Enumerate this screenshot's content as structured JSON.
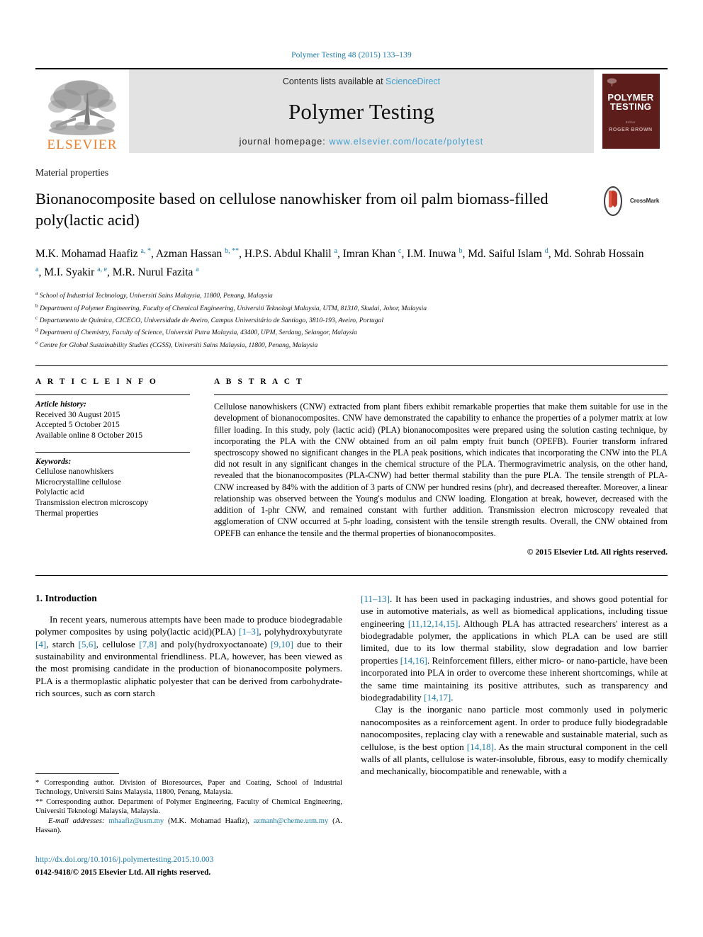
{
  "running_head": "Polymer Testing 48 (2015) 133–139",
  "masthead": {
    "publisher_name": "ELSEVIER",
    "contents_prefix": "Contents lists available at ",
    "contents_link": "ScienceDirect",
    "journal_name": "Polymer Testing",
    "homepage_prefix": "journal homepage: ",
    "homepage_url": "www.elsevier.com/locate/polytest",
    "cover": {
      "title_line1": "POLYMER",
      "title_line2": "TESTING",
      "editor_label": "Editor",
      "editor_name": "ROGER BROWN"
    }
  },
  "article": {
    "kicker": "Material properties",
    "title": "Bionanocomposite based on cellulose nanowhisker from oil palm biomass-filled poly(lactic acid)",
    "crossmark_label": "CrossMark",
    "authors": [
      {
        "name": "M.K. Mohamad Haafiz",
        "marks": "a, *",
        "sep": ", "
      },
      {
        "name": "Azman Hassan",
        "marks": "b, **",
        "sep": ", "
      },
      {
        "name": "H.P.S. Abdul Khalil",
        "marks": "a",
        "sep": ", "
      },
      {
        "name": "Imran Khan",
        "marks": "c",
        "sep": ", "
      },
      {
        "name": "I.M. Inuwa",
        "marks": "b",
        "sep": ", "
      },
      {
        "name": "Md. Saiful Islam",
        "marks": "d",
        "sep": ", "
      },
      {
        "name": "Md. Sohrab Hossain",
        "marks": "a",
        "sep": ", "
      },
      {
        "name": "M.I. Syakir",
        "marks": "a, e",
        "sep": ", "
      },
      {
        "name": "M.R. Nurul Fazita",
        "marks": "a",
        "sep": ""
      }
    ],
    "affiliations": [
      {
        "mark": "a",
        "text": "School of Industrial Technology, Universiti Sains Malaysia, 11800, Penang, Malaysia"
      },
      {
        "mark": "b",
        "text": "Department of Polymer Engineering, Faculty of Chemical Engineering, Universiti Teknologi Malaysia, UTM, 81310, Skudai, Johor, Malaysia"
      },
      {
        "mark": "c",
        "text": "Departamento de Química, CICECO, Universidade de Aveiro, Campus Universitário de Santiago, 3810-193, Aveiro, Portugal"
      },
      {
        "mark": "d",
        "text": "Department of Chemistry, Faculty of Science, Universiti Putra Malaysia, 43400, UPM, Serdang, Selangor, Malaysia"
      },
      {
        "mark": "e",
        "text": "Centre for Global Sustainability Studies (CGSS), Universiti Sains Malaysia, 11800, Penang, Malaysia"
      }
    ]
  },
  "article_info": {
    "heading": "A R T I C L E   I N F O",
    "history_label": "Article history:",
    "history": [
      "Received 30 August 2015",
      "Accepted 5 October 2015",
      "Available online 8 October 2015"
    ],
    "keywords_label": "Keywords:",
    "keywords": [
      "Cellulose nanowhiskers",
      "Microcrystalline cellulose",
      "Polylactic acid",
      "Transmission electron microscopy",
      "Thermal properties"
    ]
  },
  "abstract": {
    "heading": "A B S T R A C T",
    "text": "Cellulose nanowhiskers (CNW) extracted from plant fibers exhibit remarkable properties that make them suitable for use in the development of bionanocomposites. CNW have demonstrated the capability to enhance the properties of a polymer matrix at low filler loading. In this study, poly (lactic acid) (PLA) bionanocomposites were prepared using the solution casting technique, by incorporating the PLA with the CNW obtained from an oil palm empty fruit bunch (OPEFB). Fourier transform infrared spectroscopy showed no significant changes in the PLA peak positions, which indicates that incorporating the CNW into the PLA did not result in any significant changes in the chemical structure of the PLA. Thermogravimetric analysis, on the other hand, revealed that the bionanocomposites (PLA-CNW) had better thermal stability than the pure PLA. The tensile strength of PLA-CNW increased by 84% with the addition of 3 parts of CNW per hundred resins (phr), and decreased thereafter. Moreover, a linear relationship was observed between the Young's modulus and CNW loading. Elongation at break, however, decreased with the addition of 1-phr CNW, and remained constant with further addition. Transmission electron microscopy revealed that agglomeration of CNW occurred at 5-phr loading, consistent with the tensile strength results. Overall, the CNW obtained from OPEFB can enhance the tensile and the thermal properties of bionanocomposites.",
    "copyright": "© 2015 Elsevier Ltd. All rights reserved."
  },
  "introduction": {
    "number_title": "1.  Introduction",
    "left_para": "In recent years, numerous attempts have been made to produce biodegradable polymer composites by using poly(lactic acid)(PLA) [1–3], polyhydroxybutyrate [4], starch [5,6], cellulose [7,8] and poly(hydroxyoctanoate) [9,10] due to their sustainability and environmental friendliness. PLA, however, has been viewed as the most promising candidate in the production of bionanocomposite polymers. PLA is a thermoplastic aliphatic polyester that can be derived from carbohydrate-rich sources, such as corn starch",
    "right_para_1": "[11–13]. It has been used in packaging industries, and shows good potential for use in automotive materials, as well as biomedical applications, including tissue engineering [11,12,14,15]. Although PLA has attracted researchers' interest as a biodegradable polymer, the applications in which PLA can be used are still limited, due to its low thermal stability, slow degradation and low barrier properties [14,16]. Reinforcement fillers, either micro- or nano-particle, have been incorporated into PLA in order to overcome these inherent shortcomings, while at the same time maintaining its positive attributes, such as transparency and biodegradability [14,17].",
    "right_para_2": "Clay is the inorganic nano particle most commonly used in polymeric nanocomposites as a reinforcement agent. In order to produce fully biodegradable nanocomposites, replacing clay with a renewable and sustainable material, such as cellulose, is the best option [14,18]. As the main structural component in the cell walls of all plants, cellulose is water-insoluble, fibrous, easy to modify chemically and mechanically, biocompatible and renewable, with a"
  },
  "footnotes": {
    "corresponding_1": "* Corresponding author. Division of Bioresources, Paper and Coating, School of Industrial Technology, Universiti Sains Malaysia, 11800, Penang, Malaysia.",
    "corresponding_2": "** Corresponding author. Department of Polymer Engineering, Faculty of Chemical Engineering, Universiti Teknologi Malaysia, Malaysia.",
    "email_label": "E-mail addresses:",
    "email_1": "mhaafiz@usm.my",
    "email_1_owner": "(M.K. Mohamad Haafiz),",
    "email_2": "azmanh@cheme.utm.my",
    "email_2_owner": "(A. Hassan)."
  },
  "doi": {
    "url": "http://dx.doi.org/10.1016/j.polymertesting.2015.10.003",
    "issn_line": "0142-9418/© 2015 Elsevier Ltd. All rights reserved."
  },
  "colors": {
    "link": "#1a7aab",
    "sciencedirect": "#3f9fd0",
    "elsevier_orange": "#ec7c26",
    "cover_maroon": "#5d1e1b",
    "band_gray": "#e3e3e3"
  }
}
